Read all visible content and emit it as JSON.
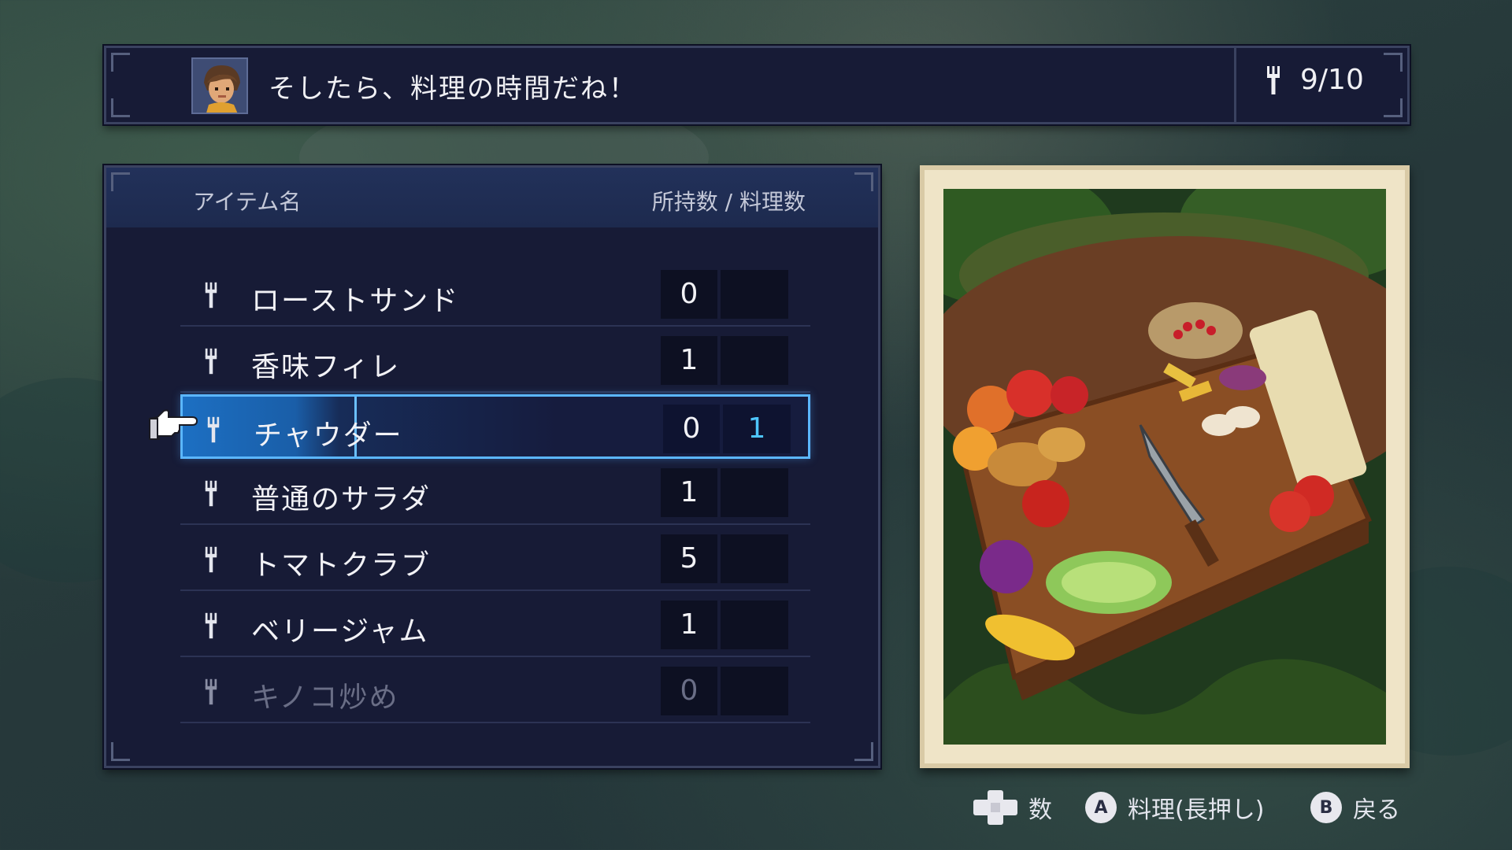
{
  "header": {
    "dialogue": "そしたら、料理の時間だね！",
    "fork_count": "9/10",
    "fork_icon": "fork-icon",
    "portrait": "character-portrait"
  },
  "list": {
    "col_name": "アイテム名",
    "col_qty": "所持数 / 料理数",
    "items": [
      {
        "name": "ローストサンド",
        "owned": "0",
        "cook": ""
      },
      {
        "name": "香味フィレ",
        "owned": "1",
        "cook": ""
      },
      {
        "name": "チャウダー",
        "owned": "0",
        "cook": "1"
      },
      {
        "name": "普通のサラダ",
        "owned": "1",
        "cook": ""
      },
      {
        "name": "トマトクラブ",
        "owned": "5",
        "cook": ""
      },
      {
        "name": "ベリージャム",
        "owned": "1",
        "cook": ""
      },
      {
        "name": "キノコ炒め",
        "owned": "0",
        "cook": ""
      }
    ],
    "selected_index": 2,
    "disabled_index": 6
  },
  "footer": {
    "dpad_label": "数",
    "a_button": "A",
    "a_label": "料理(長押し)",
    "b_button": "B",
    "b_label": "戻る"
  },
  "colors": {
    "panel": "#171b36",
    "highlight": "#1c6fc2",
    "accent": "#4ec6ff",
    "card": "#efe4c7"
  }
}
